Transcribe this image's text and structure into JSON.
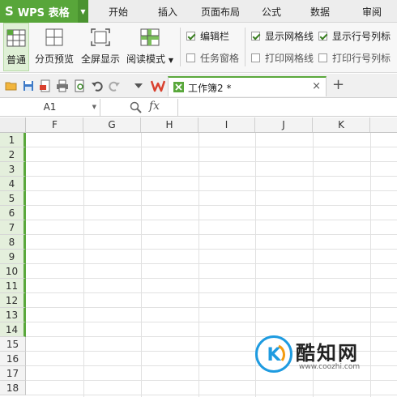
{
  "app": {
    "name": "WPS 表格",
    "logo_glyph": "S"
  },
  "menu": {
    "tabs": [
      "开始",
      "插入",
      "页面布局",
      "公式",
      "数据",
      "审阅"
    ]
  },
  "ribbon": {
    "buttons": [
      "普通",
      "分页预览",
      "全屏显示",
      "阅读模式"
    ],
    "checks": [
      {
        "label": "编辑栏",
        "checked": true
      },
      {
        "label": "任务窗格",
        "checked": false
      },
      {
        "label": "显示网格线",
        "checked": true
      },
      {
        "label": "显示行号列标",
        "checked": true
      },
      {
        "label": "打印网格线",
        "checked": false
      },
      {
        "label": "打印行号列标",
        "checked": false
      }
    ]
  },
  "document": {
    "tab_title": "工作簿2 *",
    "close_glyph": "×",
    "new_tab_glyph": "+"
  },
  "formula_bar": {
    "name_box": "A1",
    "fx_label": "fx",
    "content": ""
  },
  "sheet": {
    "columns": [
      "F",
      "G",
      "H",
      "I",
      "J",
      "K",
      ""
    ],
    "rows": [
      "1",
      "2",
      "3",
      "4",
      "5",
      "6",
      "7",
      "8",
      "9",
      "10",
      "11",
      "12",
      "13",
      "14",
      "15",
      "16",
      "17",
      "18"
    ],
    "selected_rows_through": 14
  },
  "watermark": {
    "text": "酷知网",
    "url": "www.coozhi.com"
  },
  "colors": {
    "accent": "#5aa83c",
    "app_green": "#58a63a"
  }
}
